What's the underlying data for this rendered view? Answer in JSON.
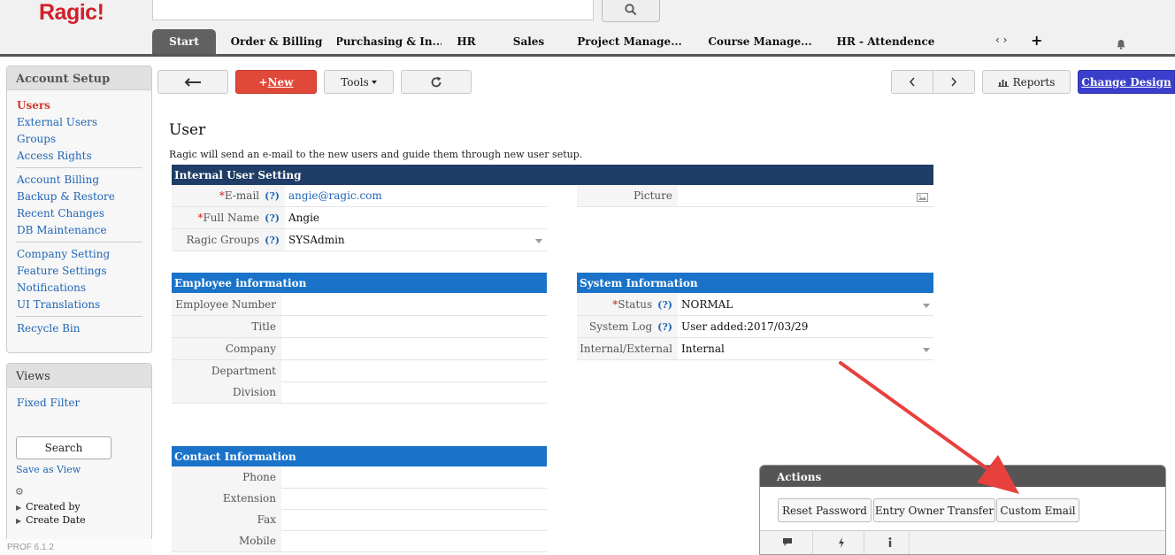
{
  "app": {
    "logo": "Ragic!",
    "version": "PROF 6.1.2"
  },
  "header": {
    "search_value": "",
    "tabs": [
      {
        "label": "Start",
        "active": true
      },
      {
        "label": "Order & Billing"
      },
      {
        "label": "Purchasing & In..."
      },
      {
        "label": "HR"
      },
      {
        "label": "Sales"
      },
      {
        "label": "Project Manage..."
      },
      {
        "label": "Course Manage..."
      },
      {
        "label": "HR - Attendence"
      }
    ],
    "tab_scroll": "‹ ›",
    "add_tab": "+"
  },
  "sidebar": {
    "account_setup": {
      "title": "Account Setup",
      "groups": [
        [
          "Users",
          "External Users",
          "Groups",
          "Access Rights"
        ],
        [
          "Account Billing",
          "Backup & Restore",
          "Recent Changes",
          "DB Maintenance"
        ],
        [
          "Company Setting",
          "Feature Settings",
          "Notifications",
          "UI Translations"
        ],
        [
          "Recycle Bin"
        ]
      ],
      "active": "Users"
    },
    "views": {
      "title": "Views",
      "fixed_filter": "Fixed Filter",
      "search_label": "Search",
      "save_as_view": "Save as View",
      "filters": [
        "Created by",
        "Create Date"
      ]
    }
  },
  "toolbar": {
    "new_plus": "+",
    "new_label": "New",
    "tools_label": "Tools",
    "reports_label": "Reports",
    "change_design_label": "Change Design"
  },
  "form": {
    "title": "User",
    "description": "Ragic will send an e-mail to the new users and guide them through new user setup.",
    "internal_user_setting": {
      "title": "Internal User Setting",
      "email_label": "E-mail",
      "email_value": "angie@ragic.com",
      "fullname_label": "Full Name",
      "fullname_value": "Angie",
      "groups_label": "Ragic Groups",
      "groups_value": "SYSAdmin",
      "picture_label": "Picture",
      "help": "(?)",
      "required_mark": "*"
    },
    "employee_information": {
      "title": "Employee information",
      "fields": [
        "Employee Number",
        "Title",
        "Company",
        "Department",
        "Division"
      ]
    },
    "system_information": {
      "title": "System Information",
      "status_label": "Status",
      "status_value": "NORMAL",
      "log_label": "System Log",
      "log_value": "User added:2017/03/29",
      "internal_label": "Internal/External",
      "internal_value": "Internal"
    },
    "contact_information": {
      "title": "Contact Information",
      "fields": [
        "Phone",
        "Extension",
        "Fax",
        "Mobile"
      ]
    }
  },
  "actions": {
    "title": "Actions",
    "buttons": [
      "Reset Password",
      "Entry Owner Transfer",
      "Custom Email"
    ]
  },
  "colors": {
    "brand_red": "#d0202a",
    "link_blue": "#2066b5",
    "section_navy": "#1f3d66",
    "section_blue": "#1a73c9",
    "change_design": "#3a3fcb",
    "annotation_arrow": "#e8403d"
  }
}
